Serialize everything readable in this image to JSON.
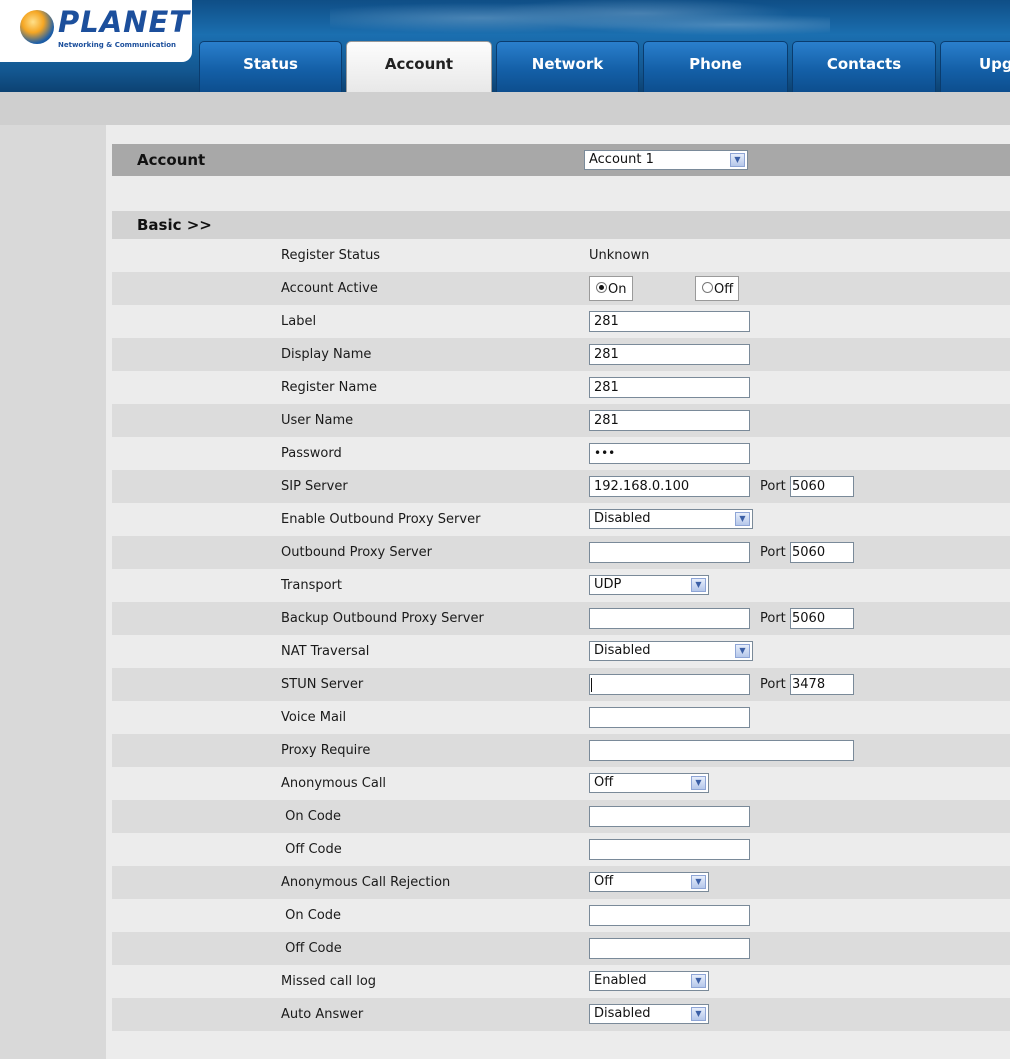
{
  "brand": {
    "name": "PLANET",
    "subtitle": "Networking & Communication"
  },
  "tabs": [
    {
      "label": "Status",
      "active": false
    },
    {
      "label": "Account",
      "active": true
    },
    {
      "label": "Network",
      "active": false
    },
    {
      "label": "Phone",
      "active": false
    },
    {
      "label": "Contacts",
      "active": false
    },
    {
      "label": "Upg",
      "active": false
    }
  ],
  "account": {
    "title": "Account",
    "selected": "Account 1"
  },
  "basic": {
    "title": "Basic >>"
  },
  "port_label": "Port",
  "fields": {
    "register_status": {
      "label": "Register Status",
      "value": "Unknown"
    },
    "account_active": {
      "label": "Account Active",
      "on_label": "On",
      "off_label": "Off",
      "selected": "On"
    },
    "label": {
      "label": "Label",
      "value": "281"
    },
    "display_name": {
      "label": "Display Name",
      "value": "281"
    },
    "register_name": {
      "label": "Register Name",
      "value": "281"
    },
    "user_name": {
      "label": "User Name",
      "value": "281"
    },
    "password": {
      "label": "Password",
      "value": "•••"
    },
    "sip_server": {
      "label": "SIP Server",
      "value": "192.168.0.100",
      "port": "5060"
    },
    "enable_outbound_proxy": {
      "label": "Enable Outbound Proxy Server",
      "value": "Disabled"
    },
    "outbound_proxy": {
      "label": "Outbound Proxy Server",
      "value": "",
      "port": "5060"
    },
    "transport": {
      "label": "Transport",
      "value": "UDP"
    },
    "backup_outbound_proxy": {
      "label": "Backup Outbound Proxy Server",
      "value": "",
      "port": "5060"
    },
    "nat_traversal": {
      "label": "NAT Traversal",
      "value": "Disabled"
    },
    "stun_server": {
      "label": "STUN Server",
      "value": "",
      "port": "3478"
    },
    "voice_mail": {
      "label": "Voice Mail",
      "value": ""
    },
    "proxy_require": {
      "label": "Proxy Require",
      "value": ""
    },
    "anonymous_call": {
      "label": "Anonymous Call",
      "value": "Off"
    },
    "anon_on_code": {
      "label": " On Code",
      "value": ""
    },
    "anon_off_code": {
      "label": " Off Code",
      "value": ""
    },
    "anonymous_call_rejection": {
      "label": "Anonymous Call Rejection",
      "value": "Off"
    },
    "rej_on_code": {
      "label": " On Code",
      "value": ""
    },
    "rej_off_code": {
      "label": " Off Code",
      "value": ""
    },
    "missed_call_log": {
      "label": "Missed call log",
      "value": "Enabled"
    },
    "auto_answer": {
      "label": "Auto Answer",
      "value": "Disabled"
    }
  },
  "colors": {
    "header_blue": "#1b6fb0",
    "active_tab": "#f0f0f0",
    "section_gray": "#a8a8a8"
  }
}
